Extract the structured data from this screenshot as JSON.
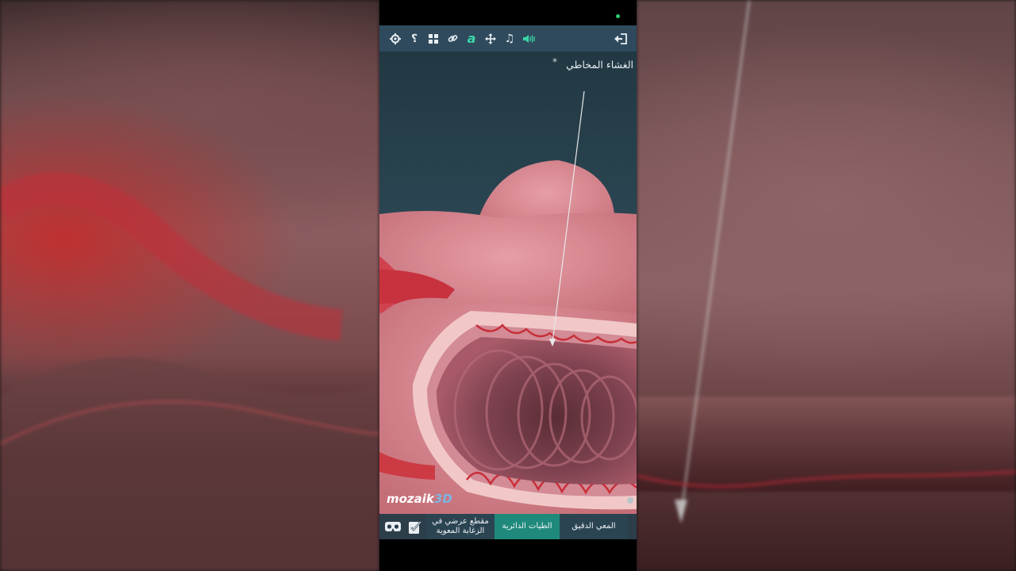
{
  "toolbar": {
    "icons": [
      "gear-icon",
      "question-icon",
      "grid-icon",
      "link-icon",
      "text-a-icon",
      "move-icon",
      "music-icon",
      "speaker-icon",
      "exit-icon"
    ],
    "accent": "#3bd6a8"
  },
  "viewport": {
    "label": "الغشاء المخاطي",
    "asterisk": "*"
  },
  "brand": {
    "name": "mozaik",
    "suffix": "3D"
  },
  "bottom_nav": {
    "tabs": [
      {
        "label": "مقطع عرضي في الزغابة المعوية"
      },
      {
        "label": "الطيات الدائرية",
        "active": true
      },
      {
        "label": "المعي الدقيق"
      }
    ],
    "active_color": "#1f8a7c"
  }
}
